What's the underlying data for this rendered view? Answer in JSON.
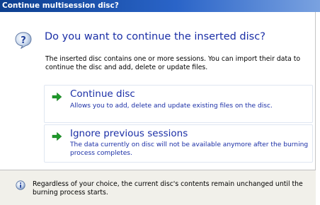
{
  "window": {
    "title": "Continue multisession disc?"
  },
  "header": {
    "icon": "question-icon",
    "question": "Do you want to continue the inserted disc?"
  },
  "description": "The inserted disc contains one or more sessions. You can import their data to continue the disc and add, delete or update files.",
  "options": [
    {
      "icon": "green-arrow-icon",
      "title": "Continue disc",
      "description": "Allows you to add, delete and update existing files on the disc."
    },
    {
      "icon": "green-arrow-icon",
      "title": "Ignore previous sessions",
      "description": "The data currently on disc will not be available anymore after the burning process completes."
    }
  ],
  "footer": {
    "icon": "info-icon",
    "text": "Regardless of your choice, the current disc's contents remain unchanged until the burning process starts."
  },
  "colors": {
    "title_bar_start": "#0c3f8f",
    "title_bar_end": "#7aa2e0",
    "link_blue": "#1a2ea6",
    "arrow_green": "#1e9a2a",
    "footer_bg": "#f1f0ea"
  }
}
